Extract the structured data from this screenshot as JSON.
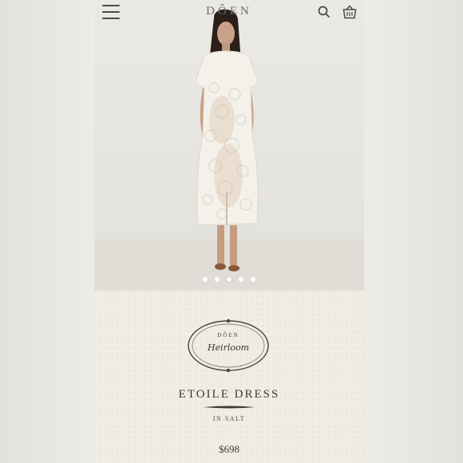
{
  "header": {
    "brand": "DÔEN",
    "menu_icon": "hamburger-icon",
    "search_icon": "search-icon",
    "cart_icon": "basket-icon"
  },
  "gallery": {
    "image_alt": "Model wearing white lace midi dress",
    "dot_count": 5,
    "active_index": 2
  },
  "product": {
    "seal_brand": "DÔEN",
    "seal_collection": "Heirloom",
    "title": "ETOILE DRESS",
    "variant": "IN SALT",
    "price": "$698"
  },
  "colors": {
    "paper": "#f1ede3",
    "text": "#3d3a36",
    "dress": "#f4f1ea"
  }
}
